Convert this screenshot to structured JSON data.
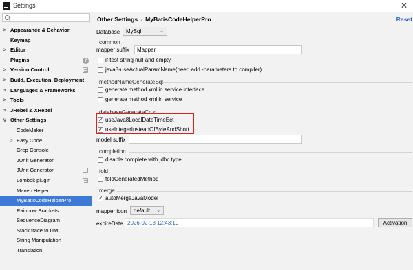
{
  "window": {
    "title": "Settings",
    "close_glyph": "✕"
  },
  "sidebar": {
    "search_placeholder": "",
    "items": [
      {
        "label": "Appearance & Behavior",
        "arrow": ">",
        "bold": true
      },
      {
        "label": "Keymap",
        "bold": true
      },
      {
        "label": "Editor",
        "arrow": ">",
        "bold": true
      },
      {
        "label": "Plugins",
        "bold": true,
        "badge": "help"
      },
      {
        "label": "Version Control",
        "arrow": ">",
        "bold": true,
        "badge": "project"
      },
      {
        "label": "Build, Execution, Deployment",
        "arrow": ">",
        "bold": true
      },
      {
        "label": "Languages & Frameworks",
        "arrow": ">",
        "bold": true
      },
      {
        "label": "Tools",
        "arrow": ">",
        "bold": true
      },
      {
        "label": "JRebel & XRebel",
        "arrow": ">",
        "bold": true
      },
      {
        "label": "Other Settings",
        "arrow": "∨",
        "bold": true
      },
      {
        "label": "CodeMaker",
        "child": true
      },
      {
        "label": "Easy Code",
        "child": true,
        "arrow": ">"
      },
      {
        "label": "Grep Console",
        "child": true
      },
      {
        "label": "JUnit Generator",
        "child": true
      },
      {
        "label": "JUnit Generator",
        "child": true,
        "badge": "project"
      },
      {
        "label": "Lombok plugin",
        "child": true,
        "badge": "project"
      },
      {
        "label": "Maven Helper",
        "child": true
      },
      {
        "label": "MyBatisCodeHelperPro",
        "child": true,
        "selected": true
      },
      {
        "label": "Rainbow Brackets",
        "child": true
      },
      {
        "label": "SequenceDiagram",
        "child": true
      },
      {
        "label": "Stack trace to UML",
        "child": true
      },
      {
        "label": "String Manipulation",
        "child": true
      },
      {
        "label": "Translation",
        "child": true
      }
    ]
  },
  "main": {
    "breadcrumb": [
      "Other Settings",
      "MyBatisCodeHelperPro"
    ],
    "breadcrumb_sep": "›",
    "reset": "Reset",
    "database_label": "Database",
    "database_value": "MySql",
    "common": {
      "title": "common",
      "mapper_suffix_label": "mapper suffix",
      "mapper_suffix_value": "Mapper",
      "cb1": {
        "label": "if test string null and empty",
        "checked": false
      },
      "cb2": {
        "label": "java8-useActualParamName(need add -parameters to compiler)",
        "checked": false
      }
    },
    "method": {
      "title": "methodNameGenerateSql",
      "cb1": {
        "label": "generate method xml in service interface",
        "checked": false
      },
      "cb2": {
        "label": "generate method xml in service",
        "checked": false
      }
    },
    "crud": {
      "title": "databaseGenerateCrud",
      "cb1": {
        "label": "useJava8LocalDateTimeEct",
        "checked": true
      },
      "cb2": {
        "label": "useIntegerInsteadOfByteAndShort",
        "checked": true
      },
      "model_suffix_label": "model suffix",
      "model_suffix_value": ""
    },
    "completion": {
      "title": "completion",
      "cb1": {
        "label": "disable complete with jdbc type",
        "checked": false
      }
    },
    "fold": {
      "title": "fold",
      "cb1": {
        "label": "foldGeneratedMethod",
        "checked": false
      }
    },
    "merge": {
      "title": "merge",
      "cb1": {
        "label": "autoMergeJavaModel",
        "checked": true
      }
    },
    "mapper_icon_label": "mapper icon",
    "mapper_icon_value": "default",
    "expire_label": "expireDate",
    "expire_value": "2026-02-13 12:43:10",
    "activation": "Activation"
  },
  "colors": {
    "selection": "#3d7ad8",
    "link": "#2a64c8",
    "highlight_box": "#e0201e"
  },
  "icons": [
    "search-icon",
    "help-icon",
    "project-icon",
    "chevron-down-icon"
  ]
}
